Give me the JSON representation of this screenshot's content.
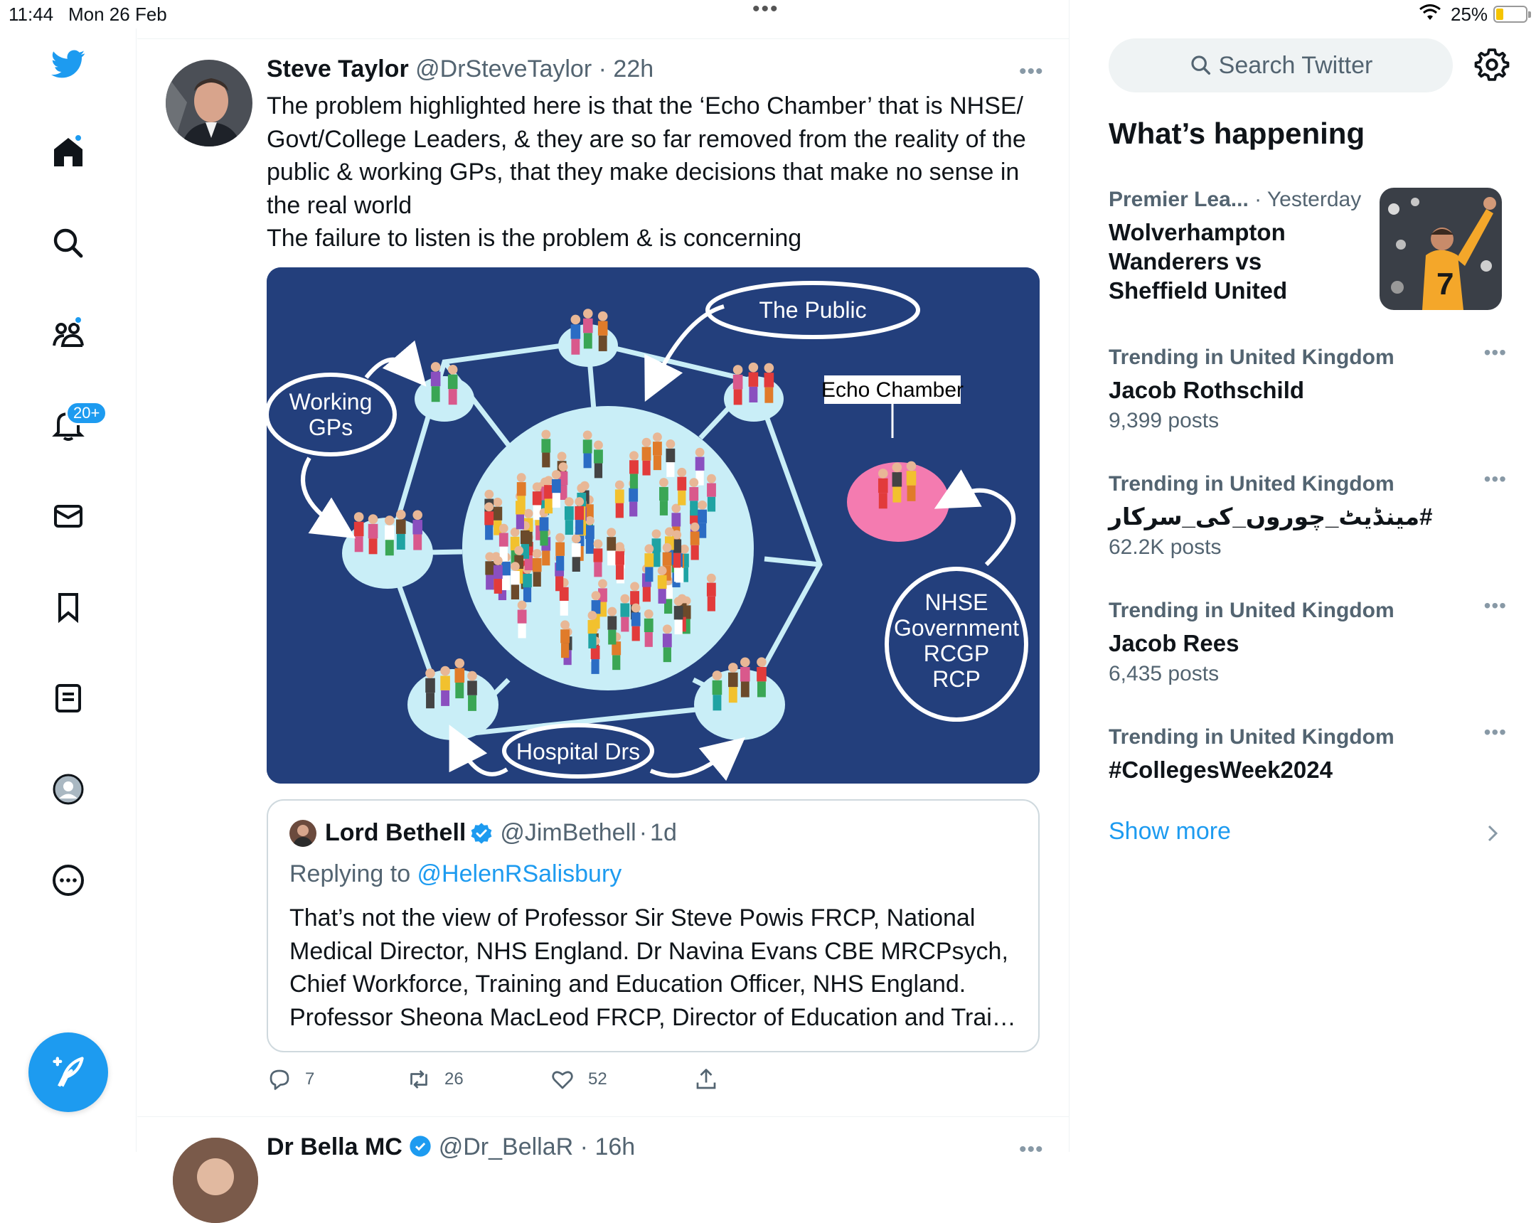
{
  "status": {
    "time": "11:44",
    "date": "Mon 26 Feb",
    "battery": "25%"
  },
  "nav": {
    "notifications_badge": "20+"
  },
  "tweet": {
    "name": "Steve Taylor",
    "handle": "@DrSteveTaylor",
    "sep": "·",
    "time": "22h",
    "text_1": "The problem highlighted here is that the ‘Echo Chamber’ that is NHSE/ Govt/College Leaders, & they are so far removed from the reality of the public & working GPs, that they make decisions that make no sense in the real world",
    "text_2": "The failure to listen is the problem & is concerning",
    "image": {
      "label_public": "The Public",
      "label_working_1": "Working",
      "label_working_2": "GPs",
      "label_echo": "Echo Chamber",
      "label_hospital": "Hospital Drs",
      "label_nhse": [
        "NHSE",
        "Government",
        "RCGP",
        "RCP"
      ],
      "colors": {
        "background": "#233f7c",
        "circle": "#c9eef7",
        "echo_circle": "#f47bb0"
      }
    },
    "quote": {
      "name": "Lord Bethell",
      "handle": "@JimBethell",
      "sep": "·",
      "time": "1d",
      "replying_prefix": "Replying to ",
      "replying_to": "@HelenRSalisbury",
      "text": "That’s not the view of Professor Sir Steve Powis FRCP, National Medical Director, NHS England. Dr Navina Evans CBE MRCPsych, Chief Workforce, Training and Education Officer, NHS England. Professor Sheona MacLeod FRCP, Director of Education and Trai…"
    },
    "replies": "7",
    "retweets": "26",
    "likes": "52"
  },
  "next_tweet": {
    "name": "Dr Bella MC",
    "handle": "@Dr_BellaR",
    "sep": "·",
    "time": "16h"
  },
  "sidebar": {
    "search_placeholder": "Search Twitter",
    "whats_happening": "What’s happening",
    "trends": [
      {
        "category": "Premier Lea...",
        "when": "· Yesterday",
        "title": "Wolverhampton Wanderers vs Sheffield United"
      },
      {
        "category": "Trending in United Kingdom",
        "title": "Jacob Rothschild",
        "count": "9,399 posts"
      },
      {
        "category": "Trending in United Kingdom",
        "title": "#مینڈیٹ_چوروں_کی_سرکار",
        "count": "62.2K posts"
      },
      {
        "category": "Trending in United Kingdom",
        "title": "Jacob Rees",
        "count": "6,435 posts"
      },
      {
        "category": "Trending in United Kingdom",
        "title": "#CollegesWeek2024"
      }
    ],
    "show_more": "Show more"
  },
  "colors": {
    "accent": "#1d9bf0",
    "text": "#0f1419",
    "secondary": "#536471"
  }
}
